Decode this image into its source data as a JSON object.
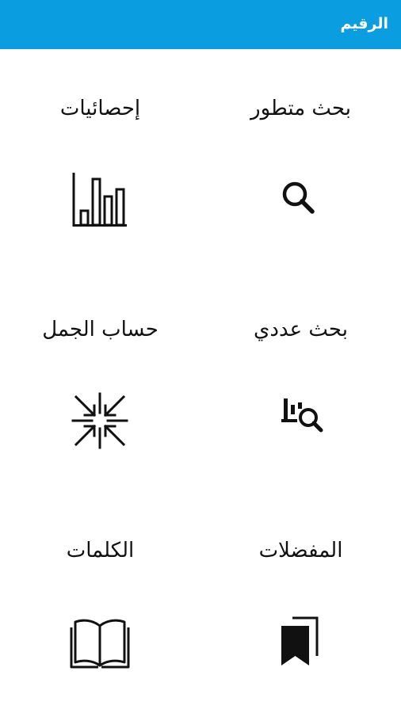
{
  "app_bar": {
    "title": "الرقيم",
    "color": "#0a9ee0"
  },
  "menu": [
    {
      "label": "بحث متطور",
      "icon": "search-icon"
    },
    {
      "label": "إحصائيات",
      "icon": "bar-chart-icon"
    },
    {
      "label": "بحث عددي",
      "icon": "numeric-search-icon"
    },
    {
      "label": "حساب الجمل",
      "icon": "compress-arrows-icon"
    },
    {
      "label": "المفضلات",
      "icon": "bookmarks-icon"
    },
    {
      "label": "الكلمات",
      "icon": "open-book-icon"
    }
  ]
}
